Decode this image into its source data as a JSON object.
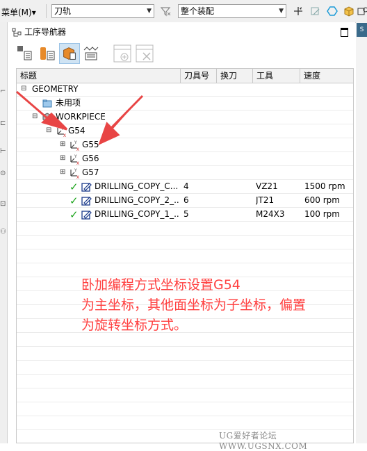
{
  "toolbar": {
    "menu_label": "菜单(M)",
    "menu_arrow": "▾",
    "filter_combo": "刀轨",
    "assembly_combo": "整个装配"
  },
  "right_tab": "S",
  "navigator": {
    "title": "工序导航器",
    "columns": [
      "标题",
      "刀具号",
      "换刀",
      "工具",
      "速度"
    ],
    "rows": [
      {
        "name": "GEOMETRY",
        "tool_no": "",
        "change": "",
        "tool": "",
        "speed": ""
      },
      {
        "name": "未用项",
        "tool_no": "",
        "change": "",
        "tool": "",
        "speed": ""
      },
      {
        "name": "WORKPIECE",
        "tool_no": "",
        "change": "",
        "tool": "",
        "speed": ""
      },
      {
        "name": "G54",
        "tool_no": "",
        "change": "",
        "tool": "",
        "speed": ""
      },
      {
        "name": "G55",
        "tool_no": "",
        "change": "",
        "tool": "",
        "speed": ""
      },
      {
        "name": "G56",
        "tool_no": "",
        "change": "",
        "tool": "",
        "speed": ""
      },
      {
        "name": "G57",
        "tool_no": "",
        "change": "",
        "tool": "",
        "speed": ""
      },
      {
        "name": "DRILLING_COPY_C...",
        "tool_no": "4",
        "change": "",
        "tool": "VZ21",
        "speed": "1500 rpm"
      },
      {
        "name": "DRILLING_COPY_2_...",
        "tool_no": "6",
        "change": "",
        "tool": "JT21",
        "speed": "600 rpm"
      },
      {
        "name": "DRILLING_COPY_1_...",
        "tool_no": "5",
        "change": "",
        "tool": "M24X3",
        "speed": "100 rpm"
      }
    ]
  },
  "annotation": {
    "line1": "卧加编程方式坐标设置G54",
    "line2": "为主坐标，其他面坐标为子坐标，偏置",
    "line3": "为旋转坐标方式。"
  },
  "watermark": "UG爱好者论坛 WWW.UGSNX.COM",
  "colors": {
    "annotation": "#ff4040",
    "arrow": "#e84545",
    "check": "#1aa31a",
    "active_button": "#cfe3f3"
  }
}
